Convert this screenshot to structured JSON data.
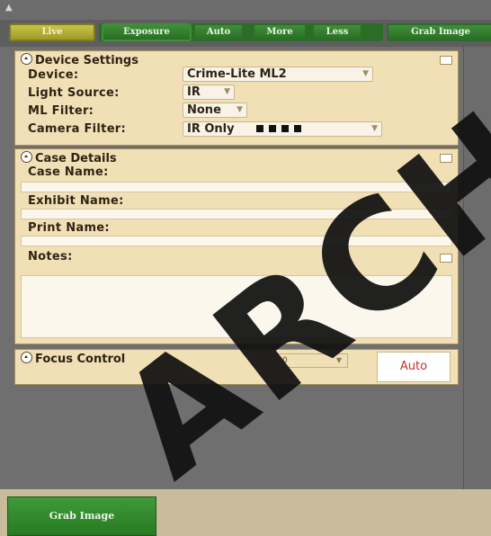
{
  "toolbar": {
    "live": "Live",
    "exposure": "Exposure",
    "auto": "Auto",
    "more": "More",
    "less": "Less",
    "grab_image": "Grab Image"
  },
  "device_settings": {
    "title": "Device Settings",
    "device_label": "Device:",
    "device_value": "Crime-Lite ML2",
    "light_source_label": "Light Source:",
    "light_source_value": "IR",
    "ml_filter_label": "ML Filter:",
    "ml_filter_value": "None",
    "camera_filter_label": "Camera Filter:",
    "camera_filter_value": "IR Only"
  },
  "case_details": {
    "title": "Case Details",
    "case_name_label": "Case Name:",
    "case_name_value": "",
    "exhibit_name_label": "Exhibit Name:",
    "exhibit_name_value": "",
    "print_name_label": "Print Name:",
    "print_name_value": "",
    "notes_label": "Notes:",
    "notes_value": ""
  },
  "focus_control": {
    "title": "Focus Control",
    "value": "0",
    "auto": "Auto"
  },
  "bottom": {
    "grab_image": "Grab Image"
  },
  "watermark": "ARCH",
  "colors": {
    "panel_bg": "#f1dfb5",
    "toolbar_green": "#2a6e25",
    "live_yellow": "#9d9a28",
    "auto_red": "#c5302b"
  }
}
